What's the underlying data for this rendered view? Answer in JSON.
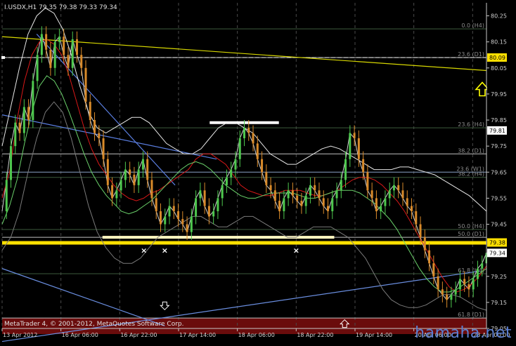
{
  "chart_data": {
    "type": "candlestick",
    "symbol_header": "I.USDX,H1  79.35 79.38 79.33 79.34",
    "copyright": "MetaTrader 4, © 2001-2012, MetaQuotes Software Corp.",
    "watermark": "hamaha.net",
    "ylim": [
      79.05,
      80.3
    ],
    "xlim": [
      0,
      140
    ],
    "y_ticks": [
      "80.25",
      "80.15",
      "80.05",
      "79.95",
      "79.85",
      "79.75",
      "79.65",
      "79.55",
      "79.45",
      "79.34",
      "79.25",
      "79.15",
      "79.05"
    ],
    "x_ticks": [
      {
        "x": 0,
        "label": "13 Apr 2012"
      },
      {
        "x": 17,
        "label": "16 Apr 06:00"
      },
      {
        "x": 34,
        "label": "16 Apr 22:00"
      },
      {
        "x": 51,
        "label": "17 Apr 14:00"
      },
      {
        "x": 68,
        "label": "18 Apr 06:00"
      },
      {
        "x": 85,
        "label": "18 Apr 22:00"
      },
      {
        "x": 102,
        "label": "19 Apr 14:00"
      },
      {
        "x": 119,
        "label": "20 Apr 06:00"
      },
      {
        "x": 136,
        "label": "23 Apr 00:00"
      }
    ],
    "price_badges": [
      {
        "value": 80.09,
        "label": "80.09",
        "bg": "#ffe000",
        "fg": "#000000"
      },
      {
        "value": 79.81,
        "label": "79.81",
        "bg": "#ffffff",
        "fg": "#000000"
      },
      {
        "value": 79.38,
        "label": "79.38",
        "bg": "#ffe000",
        "fg": "#000000"
      },
      {
        "value": 79.34,
        "label": "79.34",
        "bg": "#ffffff",
        "fg": "#000000"
      }
    ],
    "fib_levels": [
      {
        "value": 80.2,
        "label": "0.0 (H4)",
        "color": "#3c5a3c"
      },
      {
        "value": 80.09,
        "label": "23.6 (D1)",
        "color": "#c0c0c0"
      },
      {
        "value": 79.82,
        "label": "23.6 (H4)",
        "color": "#3c5a3c"
      },
      {
        "value": 79.72,
        "label": "38.2 (D1)",
        "color": "#c0c0c0"
      },
      {
        "value": 79.65,
        "label": "23.6 (W1)",
        "color": "#8aa2c8"
      },
      {
        "value": 79.63,
        "label": "38.2 (H4)",
        "color": "#3c5a3c"
      },
      {
        "value": 79.43,
        "label": "50.0 (H4)",
        "color": "#3c5a3c"
      },
      {
        "value": 79.4,
        "label": "50.0 (D1)",
        "color": "#c0c0c0"
      },
      {
        "value": 79.26,
        "label": "61.8 (H4)",
        "color": "#3c5a3c"
      },
      {
        "value": 79.09,
        "label": "61.8 (D1)",
        "color": "#c0c0c0"
      }
    ],
    "support_zone": {
      "x0": 29,
      "x1": 96,
      "value": 79.4
    },
    "support_line": {
      "value": 79.38
    },
    "resistance_bar": {
      "x0": 60,
      "x1": 80,
      "value": 79.84
    },
    "red_zone": {
      "from": 79.09,
      "to": 79.05,
      "color": "#6a0c0c"
    },
    "trendlines": [
      {
        "name": "yellow-downtrend",
        "color": "#d8d800",
        "p1": [
          0,
          80.17
        ],
        "p2": [
          140,
          80.04
        ]
      },
      {
        "name": "blue-uptrend",
        "color": "#6a8ee0",
        "p1": [
          0,
          79.0
        ],
        "p2": [
          138,
          79.27
        ]
      },
      {
        "name": "blue-downtrend",
        "color": "#6a8ee0",
        "p1": [
          0,
          79.28
        ],
        "p2": [
          47,
          79.06
        ]
      },
      {
        "name": "blue-steep-down",
        "color": "#5a7ee0",
        "p1": [
          10,
          80.18
        ],
        "p2": [
          50,
          79.6
        ]
      },
      {
        "name": "blue-long-down",
        "color": "#5a7ee0",
        "p1": [
          0,
          79.87
        ],
        "p2": [
          62,
          79.7
        ]
      }
    ],
    "markers": [
      {
        "type": "cross",
        "x": 41,
        "value": 79.35
      },
      {
        "type": "cross",
        "x": 47,
        "value": 79.35
      },
      {
        "type": "cross",
        "x": 85,
        "value": 79.35
      },
      {
        "type": "down-arrow",
        "x": 47,
        "value": 79.13
      },
      {
        "type": "up-arrow",
        "x": 99,
        "value": 79.07
      },
      {
        "type": "big-up-arrow",
        "x": 146,
        "value": 79.97
      }
    ],
    "series": [
      {
        "name": "price",
        "color": "#d0d0d0",
        "values": [
          79.5,
          79.62,
          79.75,
          79.84,
          79.8,
          79.9,
          79.85,
          80.0,
          80.1,
          80.18,
          80.12,
          80.05,
          80.15,
          80.17,
          80.1,
          80.05,
          80.16,
          80.1,
          80.05,
          79.92,
          79.85,
          79.8,
          79.78,
          79.7,
          79.6,
          79.55,
          79.58,
          79.62,
          79.66,
          79.64,
          79.6,
          79.66,
          79.7,
          79.62,
          79.55,
          79.5,
          79.45,
          79.48,
          79.52,
          79.5,
          79.47,
          79.45,
          79.42,
          79.48,
          79.55,
          79.58,
          79.52,
          79.48,
          79.5,
          79.55,
          79.6,
          79.63,
          79.66,
          79.7,
          79.78,
          79.82,
          79.8,
          79.76,
          79.7,
          79.65,
          79.6,
          79.58,
          79.54,
          79.5,
          79.55,
          79.58,
          79.56,
          79.54,
          79.52,
          79.56,
          79.6,
          79.58,
          79.55,
          79.52,
          79.5,
          79.55,
          79.58,
          79.62,
          79.7,
          79.8,
          79.78,
          79.7,
          79.65,
          79.58,
          79.55,
          79.5,
          79.52,
          79.55,
          79.58,
          79.6,
          79.58,
          79.55,
          79.52,
          79.5,
          79.45,
          79.4,
          79.35,
          79.3,
          79.25,
          79.2,
          79.18,
          79.16,
          79.18,
          79.2,
          79.24,
          79.22,
          79.2,
          79.24,
          79.28,
          79.3,
          79.34
        ]
      },
      {
        "name": "ma-red",
        "color": "#d81818",
        "values": [
          79.55,
          79.65,
          79.85,
          80.0,
          80.1,
          80.15,
          80.16,
          80.14,
          80.1,
          80.02,
          79.92,
          79.82,
          79.74,
          79.68,
          79.64,
          79.6,
          79.57,
          79.55,
          79.54,
          79.55,
          79.57,
          79.58,
          79.6,
          79.62,
          79.64,
          79.66,
          79.7,
          79.72,
          79.72,
          79.7,
          79.68,
          79.64,
          79.6,
          79.58,
          79.57,
          79.56,
          79.56,
          79.57,
          79.58,
          79.58,
          79.58,
          79.57,
          79.56,
          79.56,
          79.57,
          79.58,
          79.6,
          79.62,
          79.63,
          79.63,
          79.62,
          79.6,
          79.57,
          79.54,
          79.5,
          79.45,
          79.4,
          79.35,
          79.3,
          79.25,
          79.21,
          79.19,
          79.2,
          79.22,
          79.25,
          79.29
        ]
      },
      {
        "name": "ma-green",
        "color": "#6ad06a",
        "values": [
          79.45,
          79.52,
          79.62,
          79.76,
          79.88,
          79.98,
          80.02,
          80.0,
          79.95,
          79.88,
          79.8,
          79.72,
          79.65,
          79.6,
          79.56,
          79.53,
          79.5,
          79.49,
          79.5,
          79.52,
          79.54,
          79.57,
          79.6,
          79.63,
          79.66,
          79.68,
          79.69,
          79.68,
          79.66,
          79.63,
          79.6,
          79.58,
          79.56,
          79.55,
          79.55,
          79.56,
          79.57,
          79.57,
          79.57,
          79.57,
          79.56,
          79.55,
          79.55,
          79.56,
          79.57,
          79.58,
          79.58,
          79.58,
          79.57,
          79.55,
          79.53,
          79.5,
          79.47,
          79.43,
          79.38,
          79.33,
          79.28,
          79.24,
          79.21,
          79.19,
          79.19,
          79.2,
          79.22,
          79.24,
          79.26,
          79.28
        ]
      },
      {
        "name": "bb-upper",
        "color": "#e8e8e8",
        "values": [
          79.75,
          79.9,
          80.05,
          80.18,
          80.25,
          80.28,
          80.26,
          80.2,
          80.1,
          79.98,
          79.88,
          79.82,
          79.8,
          79.82,
          79.84,
          79.86,
          79.86,
          79.84,
          79.8,
          79.76,
          79.74,
          79.72,
          79.72,
          79.74,
          79.78,
          79.82,
          79.84,
          79.84,
          79.82,
          79.8,
          79.76,
          79.72,
          79.7,
          79.68,
          79.68,
          79.7,
          79.72,
          79.74,
          79.75,
          79.74,
          79.72,
          79.7,
          79.68,
          79.66,
          79.66,
          79.66,
          79.67,
          79.67,
          79.66,
          79.65,
          79.64,
          79.62,
          79.6,
          79.58,
          79.56,
          79.53,
          79.5
        ]
      },
      {
        "name": "bb-lower",
        "color": "#7a7a7a",
        "values": [
          79.35,
          79.4,
          79.5,
          79.65,
          79.78,
          79.88,
          79.92,
          79.88,
          79.78,
          79.65,
          79.52,
          79.42,
          79.36,
          79.32,
          79.3,
          79.3,
          79.32,
          79.36,
          79.4,
          79.42,
          79.44,
          79.46,
          79.48,
          79.48,
          79.46,
          79.44,
          79.44,
          79.46,
          79.48,
          79.48,
          79.46,
          79.44,
          79.42,
          79.4,
          79.4,
          79.42,
          79.44,
          79.44,
          79.44,
          79.42,
          79.4,
          79.36,
          79.32,
          79.26,
          79.2,
          79.16,
          79.14,
          79.13,
          79.13,
          79.14,
          79.16,
          79.18,
          79.18,
          79.17,
          79.15,
          79.13,
          79.12
        ]
      }
    ]
  }
}
